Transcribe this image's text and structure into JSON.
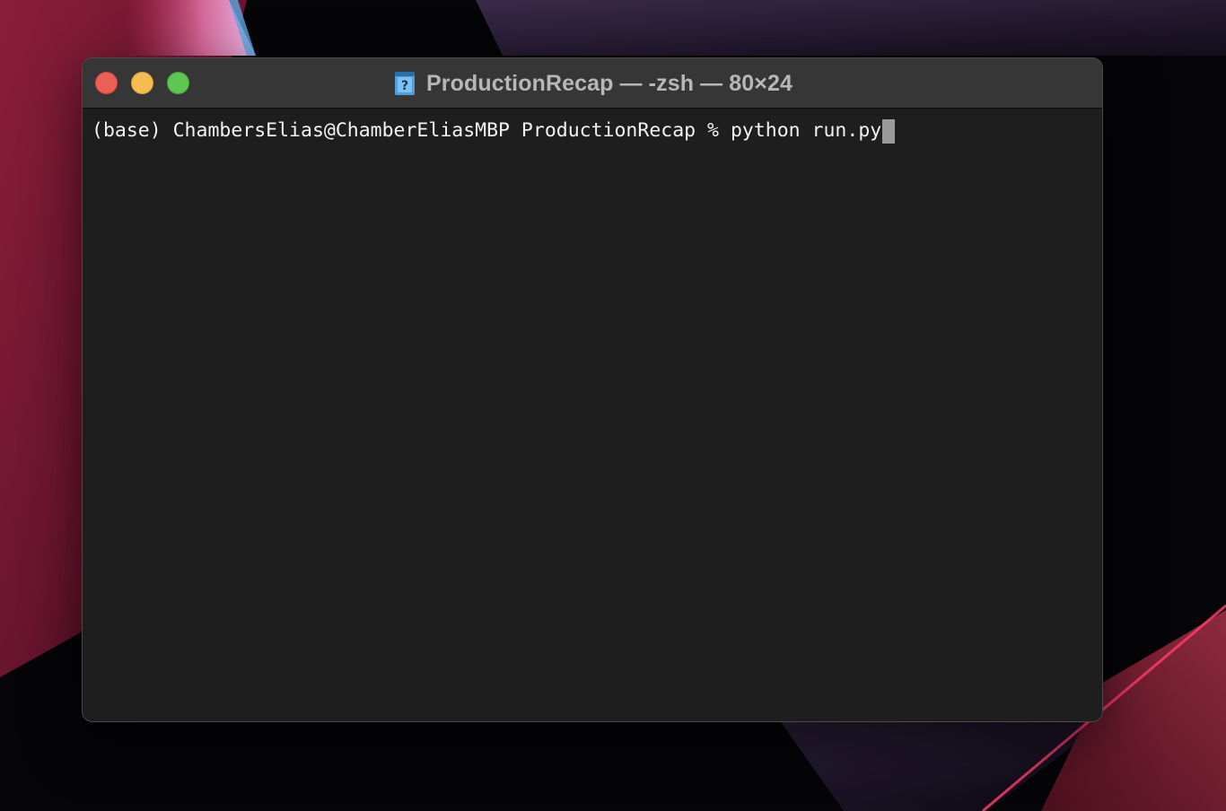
{
  "window": {
    "title": "ProductionRecap — -zsh — 80×24",
    "title_icon": "folder-question-document-icon"
  },
  "terminal": {
    "prompt": "(base) ChambersElias@ChamberEliasMBP ProductionRecap % ",
    "command": "python run.py"
  },
  "colors": {
    "terminal_background": "#1e1e1e",
    "titlebar_background": "#363636",
    "close_button": "#ec5f57",
    "minimize_button": "#f4bd4f",
    "zoom_button": "#5fc553",
    "cursor": "#9a9a9a"
  }
}
